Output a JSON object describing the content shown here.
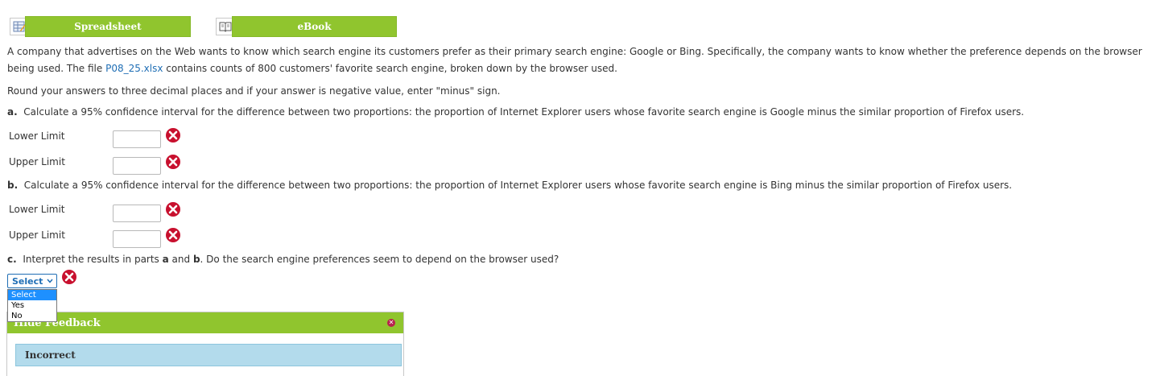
{
  "resources": {
    "spreadsheet_label": "Spreadsheet",
    "ebook_label": "eBook"
  },
  "problem": {
    "intro_line1": "A company that advertises on the Web wants to know which search engine its customers prefer as their primary search engine: Google or Bing. Specifically, the company wants to know whether the preference depends on the browser",
    "intro_line2_pre": "being used. The file ",
    "file_link": "P08_25.xlsx",
    "intro_line2_post": " contains counts of 800 customers' favorite search engine, broken down by the browser used.",
    "rounding_note": "Round your answers to three decimal places and if your answer is negative value, enter \"minus\" sign."
  },
  "part_a": {
    "label": "a.",
    "text": "Calculate a 95% confidence interval for the difference between two proportions: the proportion of Internet Explorer users whose favorite search engine is Google minus the similar proportion of Firefox users.",
    "lower_label": "Lower Limit",
    "upper_label": "Upper Limit",
    "lower_value": "",
    "upper_value": ""
  },
  "part_b": {
    "label": "b.",
    "text": "Calculate a 95% confidence interval for the difference between two proportions: the proportion of Internet Explorer users whose favorite search engine is Bing minus the similar proportion of Firefox users.",
    "lower_label": "Lower Limit",
    "upper_label": "Upper Limit",
    "lower_value": "",
    "upper_value": ""
  },
  "part_c": {
    "label": "c.",
    "text_pre": "Interpret the results in parts ",
    "a": "a",
    "mid": " and ",
    "b": "b",
    "text_post": ". Do the search engine preferences seem to depend on the browser used?",
    "selected": "Select",
    "options": [
      "Select",
      "Yes",
      "No"
    ]
  },
  "feedback": {
    "title": "Hide Feedback",
    "status": "Incorrect"
  },
  "colors": {
    "accent_green": "#90c52e",
    "link_blue": "#1f6eb5",
    "error_red": "#c8102e",
    "feedback_blue": "#b3dbec"
  }
}
